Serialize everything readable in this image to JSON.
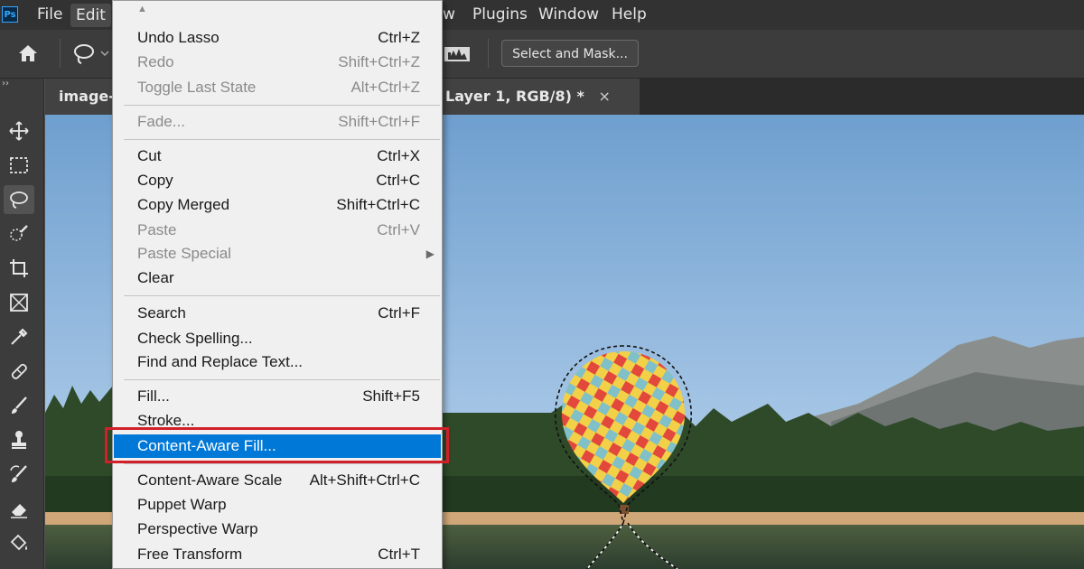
{
  "app": {
    "logo_text": "Ps"
  },
  "menubar": {
    "items": [
      {
        "label": "File"
      },
      {
        "label": "Edit"
      },
      {
        "label": "w"
      },
      {
        "label": "Plugins"
      },
      {
        "label": "Window"
      },
      {
        "label": "Help"
      }
    ]
  },
  "options_bar": {
    "select_and_mask_label": "Select and Mask..."
  },
  "tabs": {
    "left_tab": "image-f",
    "right_tab": "Layer 1, RGB/8) *",
    "close_glyph": "×"
  },
  "toolbar": {
    "collapse_glyph": "››",
    "tools": [
      "move",
      "marquee",
      "lasso",
      "quick-selection",
      "crop",
      "frame",
      "eyedropper",
      "healing",
      "brush",
      "stamp",
      "history-brush",
      "eraser",
      "paint-bucket"
    ]
  },
  "edit_menu": {
    "scroll_up_glyph": "▲",
    "submenu_arrow_glyph": "▶",
    "items": [
      {
        "label": "Undo Lasso",
        "shortcut": "Ctrl+Z",
        "enabled": true
      },
      {
        "label": "Redo",
        "shortcut": "Shift+Ctrl+Z",
        "enabled": false
      },
      {
        "label": "Toggle Last State",
        "shortcut": "Alt+Ctrl+Z",
        "enabled": false
      },
      {
        "label": "Fade...",
        "shortcut": "Shift+Ctrl+F",
        "enabled": false
      },
      {
        "label": "Cut",
        "shortcut": "Ctrl+X",
        "enabled": true
      },
      {
        "label": "Copy",
        "shortcut": "Ctrl+C",
        "enabled": true
      },
      {
        "label": "Copy Merged",
        "shortcut": "Shift+Ctrl+C",
        "enabled": true
      },
      {
        "label": "Paste",
        "shortcut": "Ctrl+V",
        "enabled": false
      },
      {
        "label": "Paste Special",
        "shortcut": "",
        "enabled": false
      },
      {
        "label": "Clear",
        "shortcut": "",
        "enabled": true
      },
      {
        "label": "Search",
        "shortcut": "Ctrl+F",
        "enabled": true
      },
      {
        "label": "Check Spelling...",
        "shortcut": "",
        "enabled": true
      },
      {
        "label": "Find and Replace Text...",
        "shortcut": "",
        "enabled": true
      },
      {
        "label": "Fill...",
        "shortcut": "Shift+F5",
        "enabled": true
      },
      {
        "label": "Stroke...",
        "shortcut": "",
        "enabled": true
      },
      {
        "label": "Content-Aware Fill...",
        "shortcut": "",
        "enabled": true,
        "highlighted": true
      },
      {
        "label": "Content-Aware Scale",
        "shortcut": "Alt+Shift+Ctrl+C",
        "enabled": true
      },
      {
        "label": "Puppet Warp",
        "shortcut": "",
        "enabled": true
      },
      {
        "label": "Perspective Warp",
        "shortcut": "",
        "enabled": true
      },
      {
        "label": "Free Transform",
        "shortcut": "Ctrl+T",
        "enabled": true
      }
    ]
  },
  "colors": {
    "highlight": "#0078d7",
    "callout_border": "#d2202a",
    "ps_blue": "#31a8ff"
  }
}
